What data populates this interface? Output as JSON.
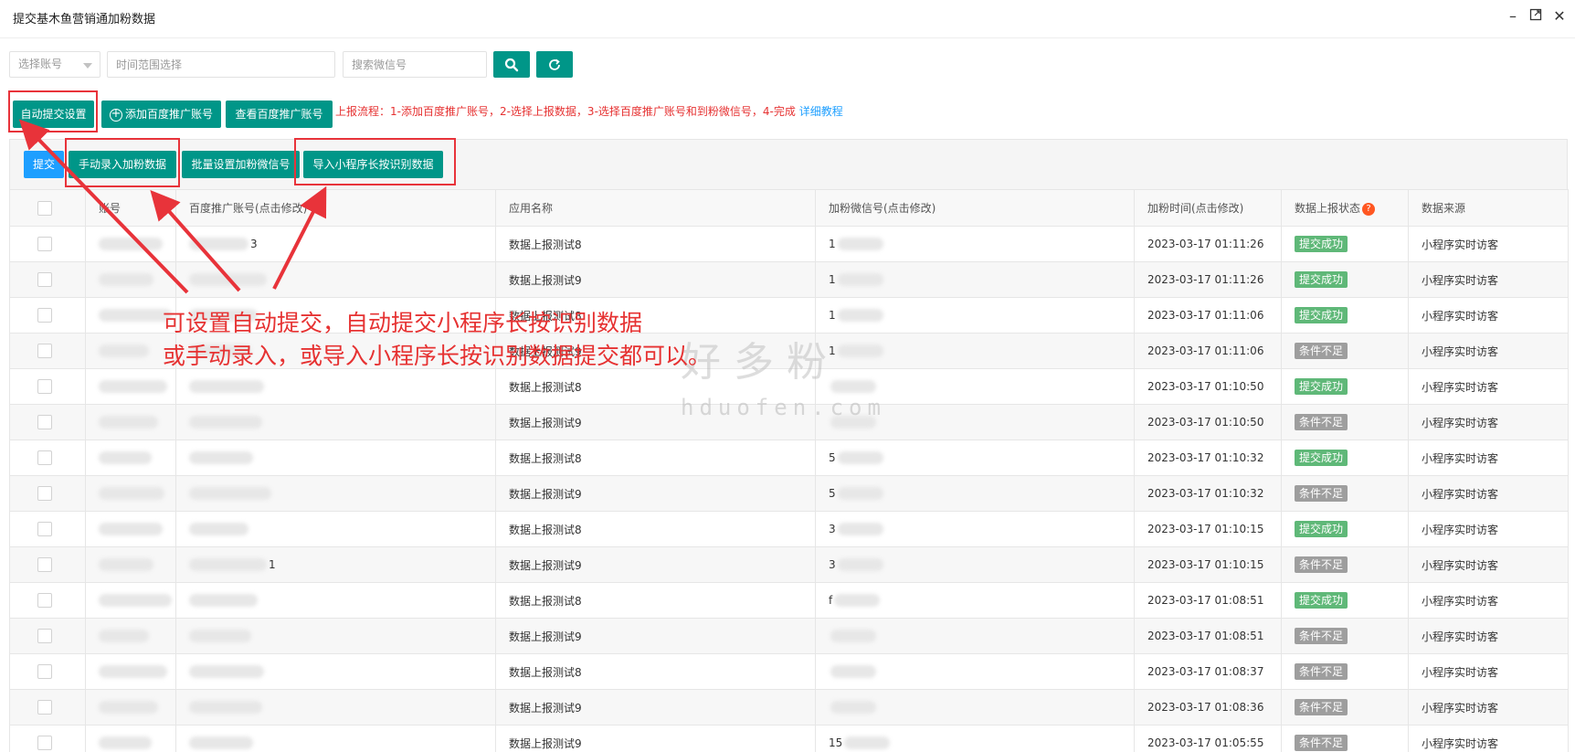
{
  "window": {
    "title": "提交基木鱼营销通加粉数据",
    "controls": [
      "minimize-icon",
      "maximize-icon",
      "close-icon"
    ]
  },
  "filters": {
    "account_select": "选择账号",
    "time_range_placeholder": "时间范围选择",
    "wechat_search_placeholder": "搜索微信号",
    "search_icon": "search-icon",
    "refresh_icon": "refresh-icon"
  },
  "toolbar": {
    "auto_submit": "自动提交设置",
    "add_baidu_account": "添加百度推广账号",
    "view_baidu_account": "查看百度推广账号",
    "flow_text": "上报流程：1-添加百度推广账号，2-选择上报数据，3-选择百度推广账号和到粉微信号，4-完成",
    "tutorial_link": "详细教程"
  },
  "actions": {
    "submit": "提交",
    "manual_entry": "手动录入加粉数据",
    "batch_set_wechat": "批量设置加粉微信号",
    "import_miniprogram": "导入小程序长按识别数据"
  },
  "table": {
    "headers": [
      "账号",
      "百度推广账号(点击修改)",
      "应用名称",
      "加粉微信号(点击修改)",
      "加粉时间(点击修改)",
      "数据上报状态",
      "数据来源"
    ],
    "status_help": "?",
    "rows": [
      {
        "account": "",
        "baidu": "3",
        "app": "数据上报测试8",
        "wechat": "1",
        "time": "2023-03-17 01:11:26",
        "status": "提交成功",
        "ok": true,
        "source": "小程序实时访客"
      },
      {
        "account": "",
        "baidu": "",
        "app": "数据上报测试9",
        "wechat": "1",
        "time": "2023-03-17 01:11:26",
        "status": "提交成功",
        "ok": true,
        "source": "小程序实时访客"
      },
      {
        "account": "",
        "baidu": "",
        "app": "数据上报测试8",
        "wechat": "1",
        "time": "2023-03-17 01:11:06",
        "status": "提交成功",
        "ok": true,
        "source": "小程序实时访客"
      },
      {
        "account": "",
        "baidu": "",
        "app": "数据上报测试9",
        "wechat": "1",
        "time": "2023-03-17 01:11:06",
        "status": "条件不足",
        "ok": false,
        "source": "小程序实时访客"
      },
      {
        "account": "",
        "baidu": "",
        "app": "数据上报测试8",
        "wechat": "",
        "time": "2023-03-17 01:10:50",
        "status": "提交成功",
        "ok": true,
        "source": "小程序实时访客"
      },
      {
        "account": "",
        "baidu": "",
        "app": "数据上报测试9",
        "wechat": "",
        "time": "2023-03-17 01:10:50",
        "status": "条件不足",
        "ok": false,
        "source": "小程序实时访客"
      },
      {
        "account": "",
        "baidu": "",
        "app": "数据上报测试8",
        "wechat": "5",
        "time": "2023-03-17 01:10:32",
        "status": "提交成功",
        "ok": true,
        "source": "小程序实时访客"
      },
      {
        "account": "",
        "baidu": "",
        "app": "数据上报测试9",
        "wechat": "5",
        "time": "2023-03-17 01:10:32",
        "status": "条件不足",
        "ok": false,
        "source": "小程序实时访客"
      },
      {
        "account": "",
        "baidu": "",
        "app": "数据上报测试8",
        "wechat": "3",
        "time": "2023-03-17 01:10:15",
        "status": "提交成功",
        "ok": true,
        "source": "小程序实时访客"
      },
      {
        "account": "",
        "baidu": "1",
        "app": "数据上报测试9",
        "wechat": "3",
        "time": "2023-03-17 01:10:15",
        "status": "条件不足",
        "ok": false,
        "source": "小程序实时访客"
      },
      {
        "account": "",
        "baidu": "",
        "app": "数据上报测试8",
        "wechat": "f",
        "time": "2023-03-17 01:08:51",
        "status": "提交成功",
        "ok": true,
        "source": "小程序实时访客"
      },
      {
        "account": "",
        "baidu": "",
        "app": "数据上报测试9",
        "wechat": "",
        "time": "2023-03-17 01:08:51",
        "status": "条件不足",
        "ok": false,
        "source": "小程序实时访客"
      },
      {
        "account": "",
        "baidu": "",
        "app": "数据上报测试8",
        "wechat": "",
        "time": "2023-03-17 01:08:37",
        "status": "条件不足",
        "ok": false,
        "source": "小程序实时访客"
      },
      {
        "account": "",
        "baidu": "",
        "app": "数据上报测试9",
        "wechat": "",
        "time": "2023-03-17 01:08:36",
        "status": "条件不足",
        "ok": false,
        "source": "小程序实时访客"
      },
      {
        "account": "",
        "baidu": "",
        "app": "数据上报测试9",
        "wechat": "15",
        "time": "2023-03-17 01:05:55",
        "status": "条件不足",
        "ok": false,
        "source": "小程序实时访客"
      }
    ]
  },
  "annotation": {
    "line1": "可设置自动提交，自动提交小程序长按识别数据",
    "line2": "或手动录入，或导入小程序长按识别数据提交都可以。"
  },
  "watermark": {
    "text": "好多粉",
    "domain": "hduofen.com"
  },
  "colors": {
    "primary": "#009688",
    "blue": "#1e9fff",
    "success": "#5fb878",
    "disabled": "#9e9e9e",
    "annotation_red": "#e63232"
  }
}
